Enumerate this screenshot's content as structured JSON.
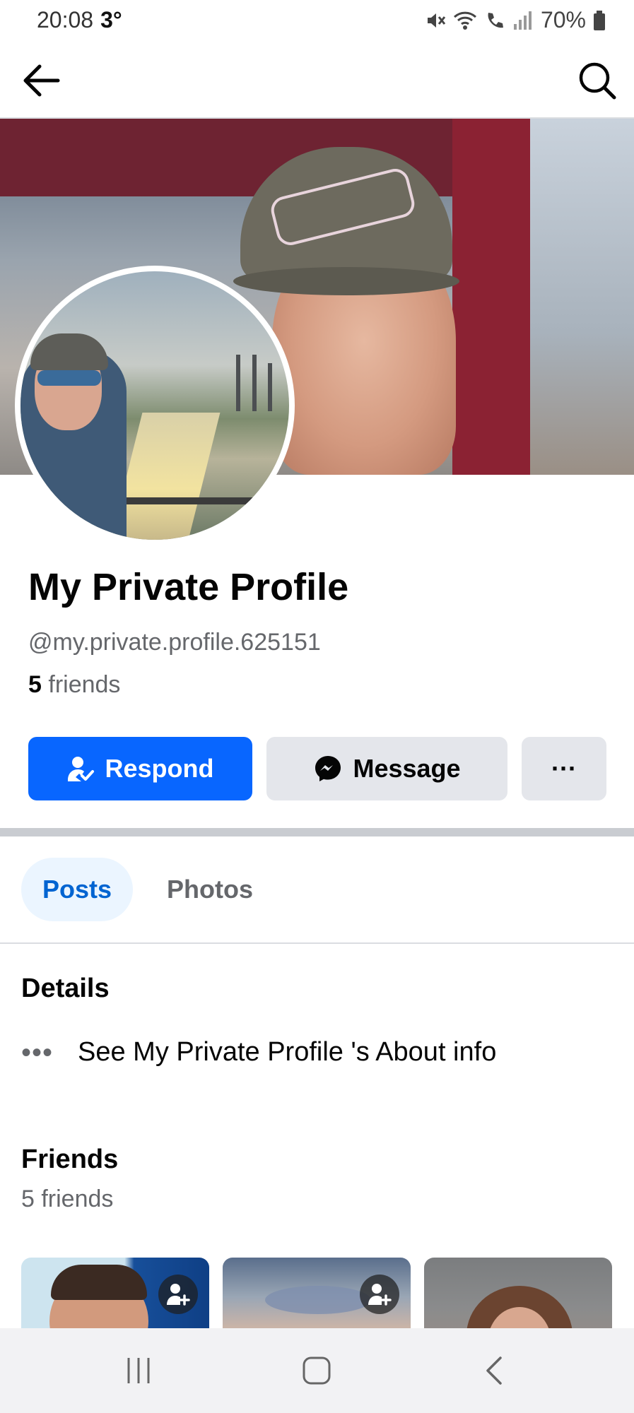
{
  "status_bar": {
    "time": "20:08",
    "temperature": "3°",
    "battery": "70%",
    "icons": [
      "mute-icon",
      "wifi-icon",
      "wifi-call-icon",
      "signal-icon",
      "battery-icon"
    ]
  },
  "top_nav": {
    "back_icon": "arrow-left-icon",
    "search_icon": "search-icon"
  },
  "profile": {
    "name": "My Private Profile",
    "handle": "@my.private.profile.625151",
    "friends_count": "5",
    "friends_label": "friends"
  },
  "actions": {
    "respond_label": "Respond",
    "message_label": "Message",
    "more_label": "···"
  },
  "tabs": {
    "posts": "Posts",
    "photos": "Photos"
  },
  "details": {
    "heading": "Details",
    "about_dots": "•••",
    "about_text": "See My Private Profile 's About info"
  },
  "friends": {
    "heading": "Friends",
    "count_text": "5 friends"
  },
  "colors": {
    "primary": "#0866ff",
    "secondary_button": "#e4e6eb",
    "tab_active_bg": "#ebf5ff",
    "tab_active_text": "#0064d1",
    "muted_text": "#65676b"
  }
}
